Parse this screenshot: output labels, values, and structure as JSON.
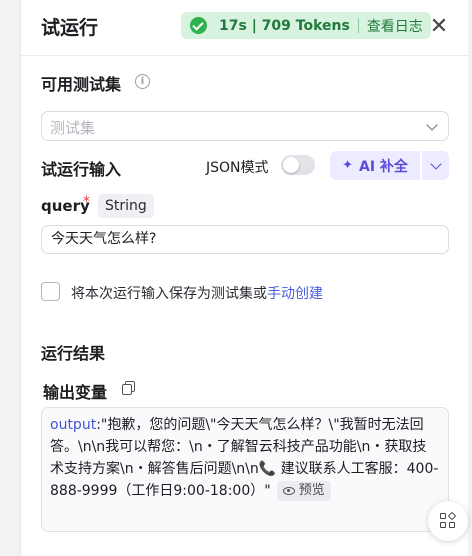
{
  "header": {
    "title": "试运行",
    "run_stats": "17s | 709 Tokens",
    "view_log_label": "查看日志",
    "status_color": "#2fb14e"
  },
  "test_set": {
    "label": "可用测试集",
    "placeholder": "测试集"
  },
  "run_input": {
    "label": "试运行输入",
    "json_mode_label": "JSON模式",
    "json_mode_on": false,
    "ai_fill_label": "AI 补全",
    "param": {
      "name": "query",
      "required_mark": "*",
      "type": "String",
      "value": "今天天气怎么样?"
    },
    "save_text": "将本次运行输入保存为测试集或",
    "save_link": "手动创建"
  },
  "result": {
    "label": "运行结果",
    "output_label": "输出变量",
    "output_key": "output",
    "output_value": ":\"抱歉，您的问题\\\"今天天气怎么样？\\\"我暂时无法回答。\\n\\n我可以帮您：\\n・了解智云科技产品功能\\n・获取技术支持方案\\n・解答售后问题\\n\\n📞 建议联系人工客服：400-888-9999（工作日9:00-18:00）\"",
    "preview_label": "预览"
  },
  "accent_color": "#5b4bdb",
  "link_color": "#4d5fe0"
}
